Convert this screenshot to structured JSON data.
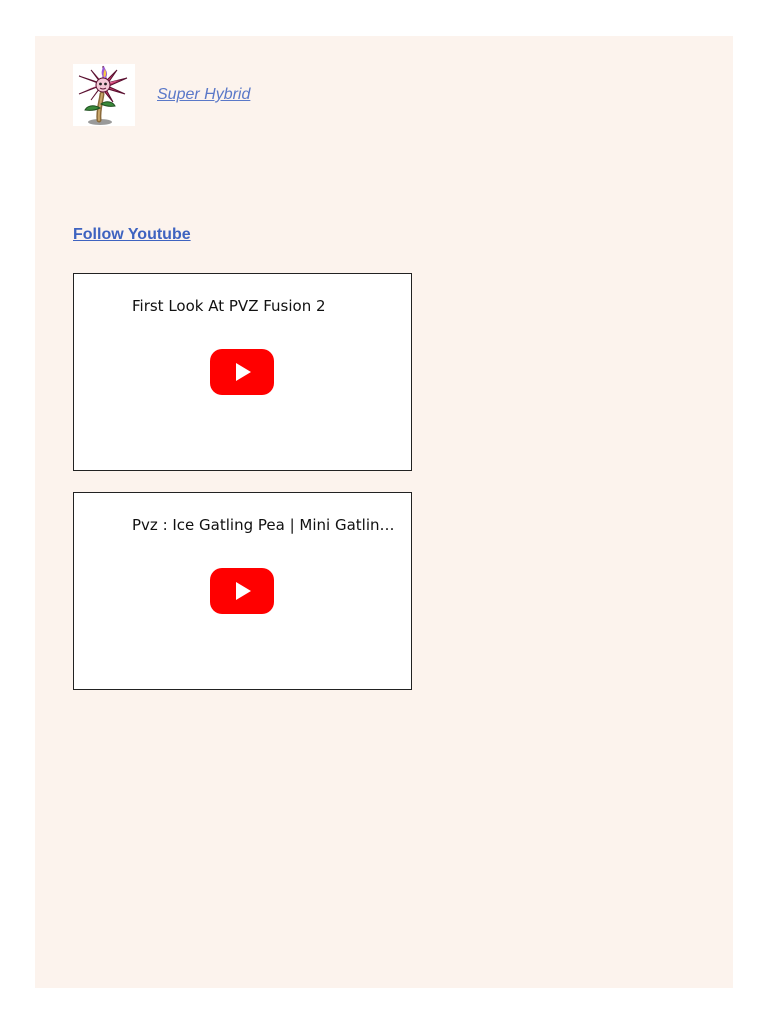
{
  "game": {
    "title": "Super Hybrid",
    "thumbnail_icon": "spiky-flower-plant-icon"
  },
  "follow": {
    "label": "Follow Youtube"
  },
  "videos": [
    {
      "title": "First Look At PVZ Fusion 2",
      "play_icon": "youtube-play-icon"
    },
    {
      "title": "Pvz : Ice Gatling Pea | Mini Gatling Pea",
      "play_icon": "youtube-play-icon"
    }
  ],
  "colors": {
    "panel_background": "#fcf3ed",
    "link": "#5a78c8",
    "youtube_red": "#ff0000"
  }
}
